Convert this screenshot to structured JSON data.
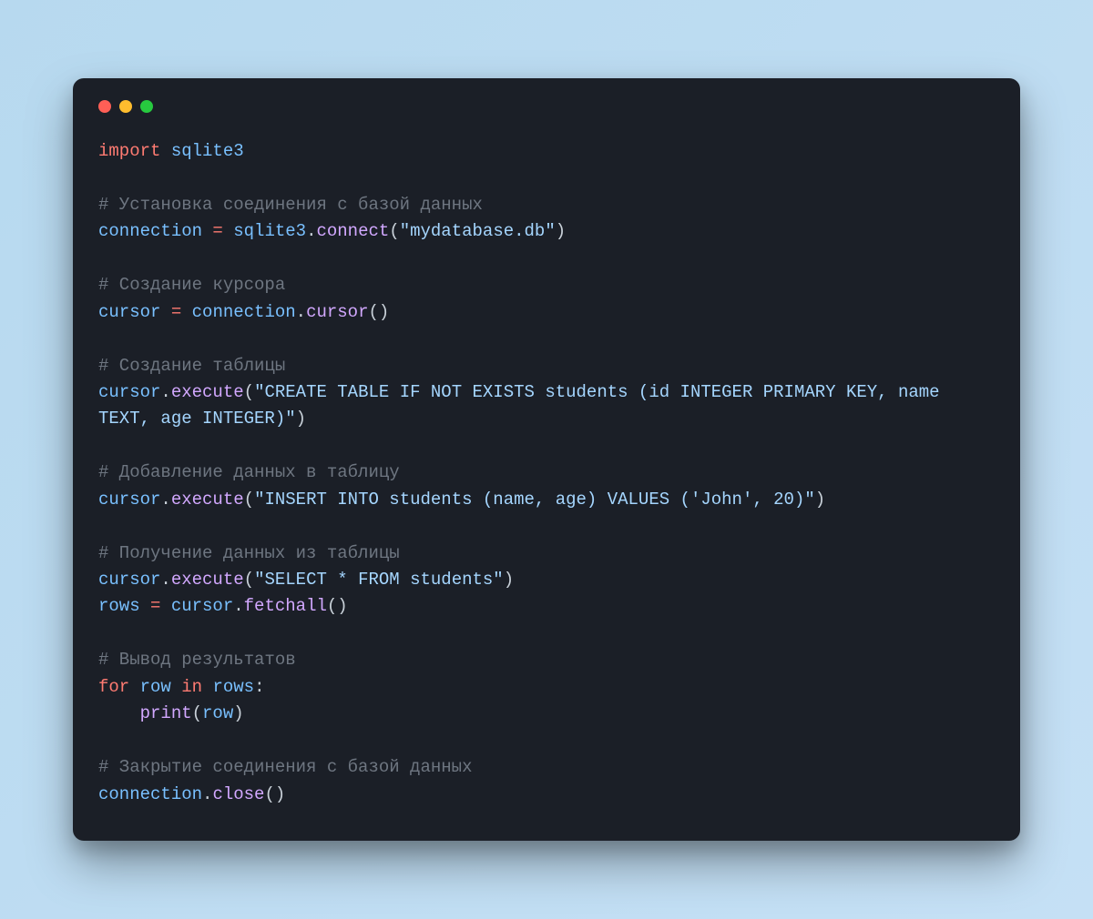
{
  "window": {
    "dots": [
      "red",
      "yellow",
      "green"
    ]
  },
  "code": {
    "l1_kw": "import",
    "l1_mod": " sqlite3",
    "blank": " ",
    "c1": "# Установка соединения с базой данных",
    "l2_var": "connection ",
    "l2_eq": "= ",
    "l2_mod": "sqlite3",
    "l2_dot": ".",
    "l2_fn": "connect",
    "l2_p1": "(",
    "l2_str": "\"mydatabase.db\"",
    "l2_p2": ")",
    "c2": "# Создание курсора",
    "l3_var": "cursor ",
    "l3_eq": "= ",
    "l3_obj": "connection",
    "l3_dot": ".",
    "l3_fn": "cursor",
    "l3_p": "()",
    "c3": "# Создание таблицы",
    "l4_obj": "cursor",
    "l4_dot": ".",
    "l4_fn": "execute",
    "l4_p1": "(",
    "l4_str": "\"CREATE TABLE IF NOT EXISTS students (id INTEGER PRIMARY KEY, name TEXT, age INTEGER)\"",
    "l4_p2": ")",
    "c4": "# Добавление данных в таблицу",
    "l5_obj": "cursor",
    "l5_dot": ".",
    "l5_fn": "execute",
    "l5_p1": "(",
    "l5_str": "\"INSERT INTO students (name, age) VALUES ('John', 20)\"",
    "l5_p2": ")",
    "c5": "# Получение данных из таблицы",
    "l6_obj": "cursor",
    "l6_dot": ".",
    "l6_fn": "execute",
    "l6_p1": "(",
    "l6_str": "\"SELECT * FROM students\"",
    "l6_p2": ")",
    "l7_var": "rows ",
    "l7_eq": "= ",
    "l7_obj": "cursor",
    "l7_dot": ".",
    "l7_fn": "fetchall",
    "l7_p": "()",
    "c6": "# Вывод результатов",
    "l8_for": "for",
    "l8_row": " row ",
    "l8_in": "in",
    "l8_rows": " rows",
    "l8_colon": ":",
    "l9_indent": "    ",
    "l9_fn": "print",
    "l9_p1": "(",
    "l9_arg": "row",
    "l9_p2": ")",
    "c7": "# Закрытие соединения с базой данных",
    "l10_obj": "connection",
    "l10_dot": ".",
    "l10_fn": "close",
    "l10_p": "()"
  }
}
